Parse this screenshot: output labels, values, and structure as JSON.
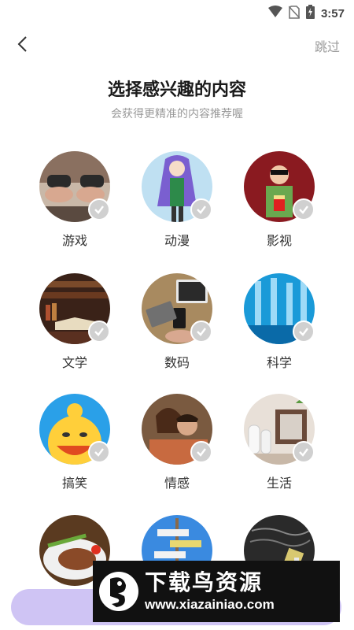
{
  "status_bar": {
    "time": "3:57",
    "icons": [
      "wifi-icon",
      "no-sim-icon",
      "battery-charging-icon"
    ]
  },
  "header": {
    "back_icon": "chevron-left-icon",
    "skip_label": "跳过"
  },
  "page": {
    "title": "选择感兴趣的内容",
    "subtitle": "会获得更精准的内容推荐喔"
  },
  "interests": [
    {
      "label": "游戏",
      "selected": false
    },
    {
      "label": "动漫",
      "selected": false
    },
    {
      "label": "影视",
      "selected": false
    },
    {
      "label": "文学",
      "selected": false
    },
    {
      "label": "数码",
      "selected": false
    },
    {
      "label": "科学",
      "selected": false
    },
    {
      "label": "搞笑",
      "selected": false
    },
    {
      "label": "情感",
      "selected": false
    },
    {
      "label": "生活",
      "selected": false
    },
    {
      "label": "",
      "selected": false
    },
    {
      "label": "",
      "selected": false
    },
    {
      "label": "",
      "selected": false
    }
  ],
  "watermark": {
    "title": "下载鸟资源",
    "url": "www.xiazainiao.com"
  },
  "colors": {
    "accent_button": "#cfc4f4",
    "check_unselected": "#d0d0d0",
    "skip_text": "#9a9a9a"
  }
}
